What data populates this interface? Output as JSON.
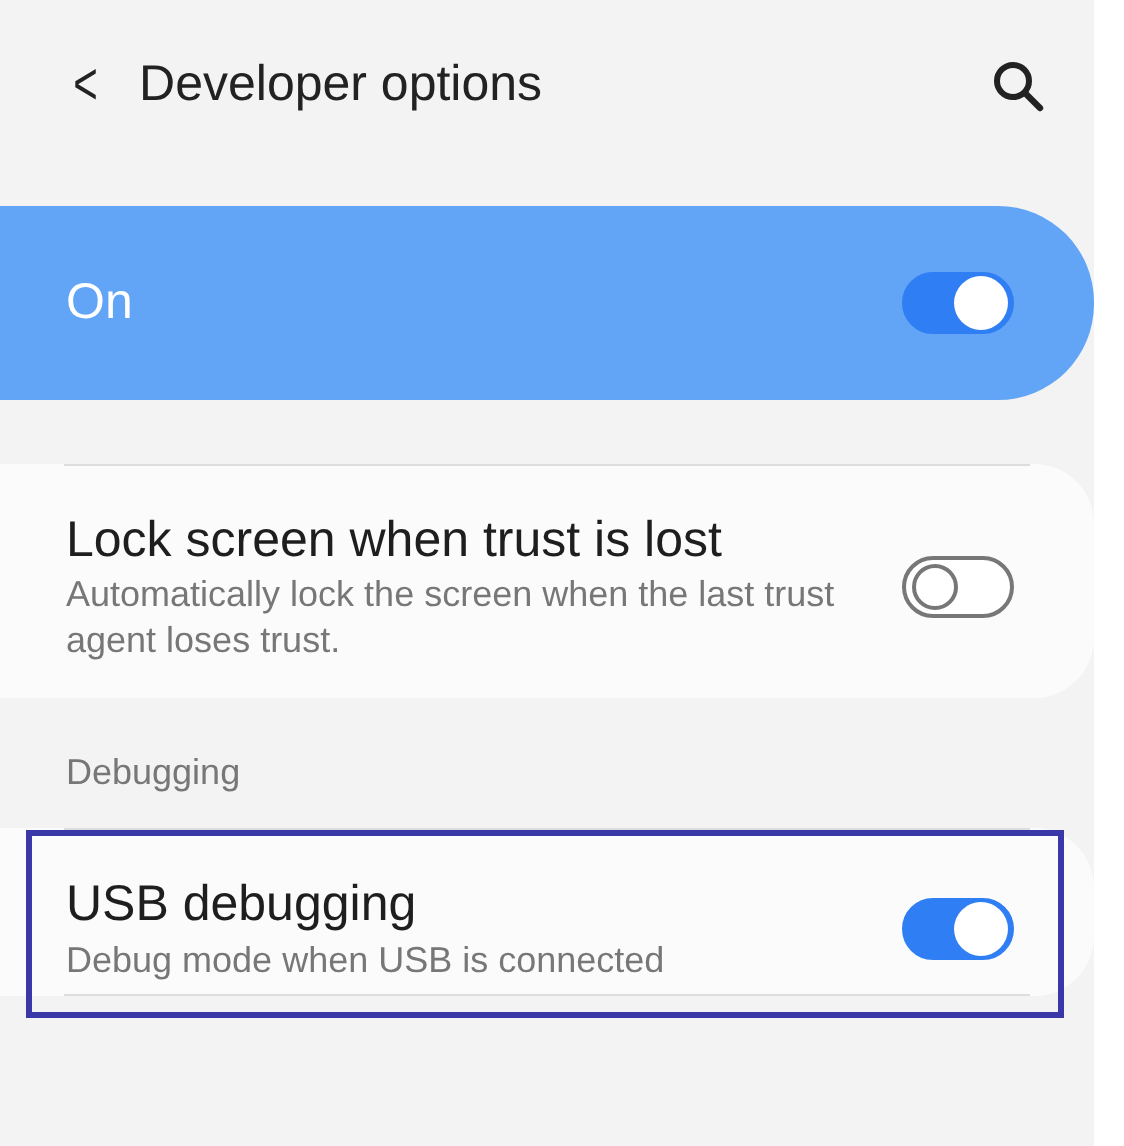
{
  "header": {
    "back": "<",
    "title": "Developer options"
  },
  "master": {
    "label": "On",
    "on": true
  },
  "settings": [
    {
      "kind": "setting",
      "title": "Lock screen when trust is lost",
      "subtitle": "Automatically lock the screen when the last trust agent loses trust.",
      "on": false,
      "highlighted": false
    },
    {
      "kind": "section",
      "title": "Debugging"
    },
    {
      "kind": "setting",
      "title": "USB debugging",
      "subtitle": "Debug mode when USB is connected",
      "on": true,
      "highlighted": true
    }
  ]
}
